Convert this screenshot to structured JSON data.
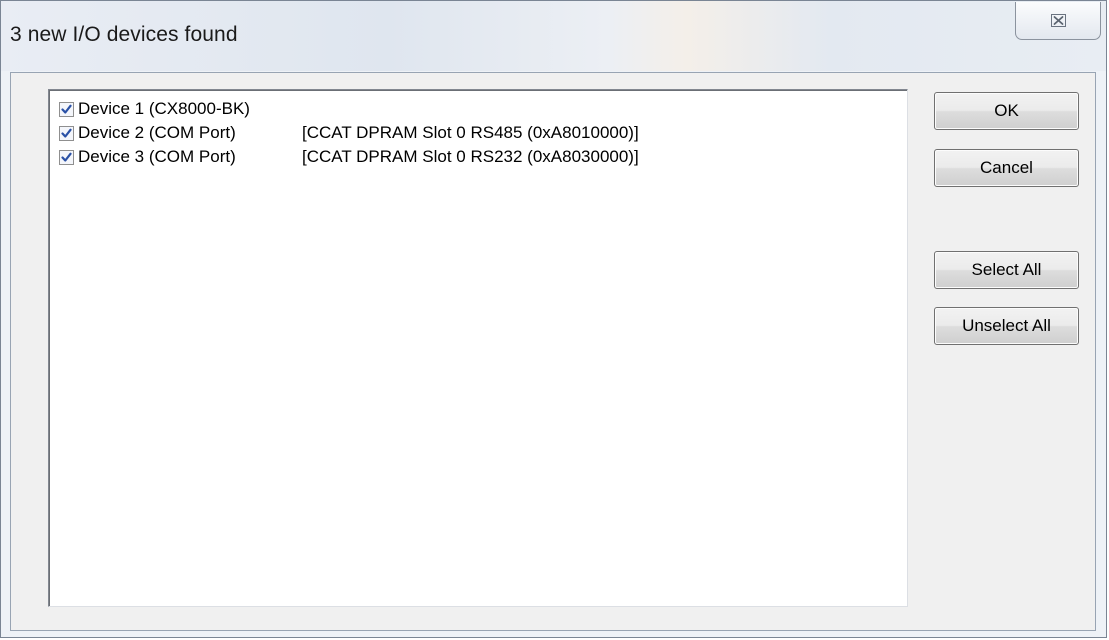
{
  "window": {
    "title": "3 new I/O devices found",
    "close_glyph": "⊠"
  },
  "devices": [
    {
      "name": "Device 1 (CX8000-BK)",
      "detail": "",
      "checked": true
    },
    {
      "name": "Device 2 (COM Port)",
      "detail": "[CCAT DPRAM Slot 0 RS485 (0xA8010000)]",
      "checked": true
    },
    {
      "name": "Device 3 (COM Port)",
      "detail": "[CCAT DPRAM Slot 0 RS232 (0xA8030000)]",
      "checked": true
    }
  ],
  "buttons": {
    "ok": "OK",
    "cancel": "Cancel",
    "select_all": "Select All",
    "unselect_all": "Unselect All"
  },
  "colors": {
    "checkmark": "#2a51a6",
    "titlebar": "#dfe6ef"
  },
  "icons": {
    "close": "close-icon",
    "checkbox": "checkmark-icon"
  }
}
